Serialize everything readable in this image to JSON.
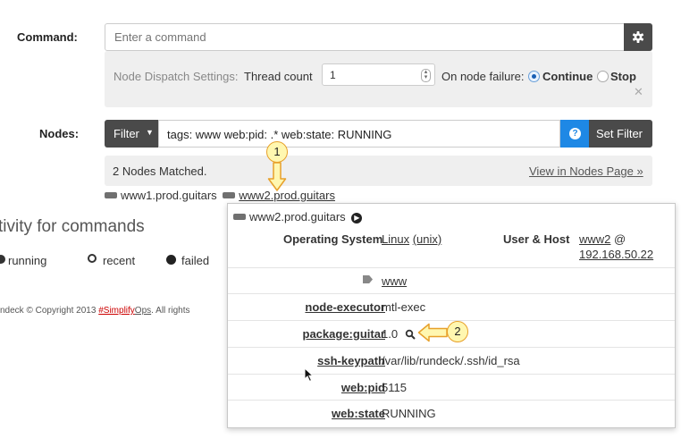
{
  "command": {
    "label": "Command:",
    "placeholder": "Enter a command",
    "settings_icon": "gear-icon"
  },
  "dispatch": {
    "prefix": "Node Dispatch Settings:",
    "thread_label": "Thread count",
    "thread_value": "1",
    "failure_label": "On node failure:",
    "continue_label": "Continue",
    "stop_label": "Stop",
    "close_icon": "close-icon",
    "selected": "Continue"
  },
  "nodes": {
    "label": "Nodes:",
    "filter_button": "Filter",
    "filter_value": "tags: www web:pid: .* web:state: RUNNING",
    "help_icon": "question-icon",
    "set_filter": "Set Filter",
    "matched": "2 Nodes Matched.",
    "view_link": "View in Nodes Page »",
    "node_list": [
      "www1.prod.guitars",
      "www2.prod.guitars"
    ]
  },
  "activity": {
    "heading": "tivity for commands",
    "tabs": [
      "running",
      "recent",
      "failed"
    ]
  },
  "footer": {
    "prefix": "ndeck © Copyright 2013 ",
    "link_simplify": "#Simplify",
    "link_ops": "Ops",
    "suffix": ". All rights"
  },
  "popover": {
    "title": "www2.prod.guitars",
    "os_label": "Operating System",
    "os_value": "Linux",
    "os_family": "(unix)",
    "user_host_label": "User & Host",
    "user_value": "www2",
    "at": "@",
    "host_value": "192.168.50.22",
    "tag": "www",
    "attributes": [
      {
        "key": "node-executor",
        "value": "mtl-exec"
      },
      {
        "key": "package:guitar",
        "value": "1.0"
      },
      {
        "key": "ssh-keypath",
        "value": "/var/lib/rundeck/.ssh/id_rsa"
      },
      {
        "key": "web:pid",
        "value": "5115"
      },
      {
        "key": "web:state",
        "value": "RUNNING"
      }
    ]
  },
  "callouts": [
    "1",
    "2"
  ],
  "colors": {
    "dark_button": "#4a4a4a",
    "help_blue": "#1e88e5",
    "callout_fill": "#fff7b0",
    "callout_stroke": "#e7a02a",
    "brand_red": "#cc0000"
  }
}
